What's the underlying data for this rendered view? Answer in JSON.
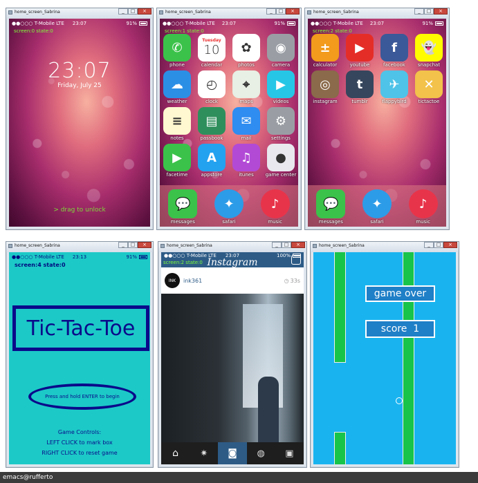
{
  "window_title": "home_screen_Sabrina",
  "titlebar_controls": [
    "_",
    "□",
    "×"
  ],
  "status": {
    "carrier": "●●○○○ T-Mobile   LTE",
    "battery": "91%"
  },
  "screen0": {
    "debug": "screen:0 state:0",
    "time_status": "23:07",
    "clock": "23:07",
    "date": "Friday, July 25",
    "unlock": "> drag to unlock"
  },
  "screen1": {
    "debug": "screen:1 state:0",
    "time_status": "23:07",
    "apps": [
      {
        "label": "phone",
        "color": "#3bc24a",
        "glyph": "✆"
      },
      {
        "label": "calendar",
        "color": "#ffffff",
        "glyph": "10",
        "sub": "Tuesday"
      },
      {
        "label": "photos",
        "color": "#ffffff",
        "glyph": "✿"
      },
      {
        "label": "camera",
        "color": "#9a9ea4",
        "glyph": "◉"
      },
      {
        "label": "weather",
        "color": "#2c8fe6",
        "glyph": "☁"
      },
      {
        "label": "clock",
        "color": "#ffffff",
        "glyph": "◴"
      },
      {
        "label": "maps",
        "color": "#e8efe4",
        "glyph": "⌖"
      },
      {
        "label": "videos",
        "color": "#26c7e6",
        "glyph": "▶"
      },
      {
        "label": "notes",
        "color": "#fff8d0",
        "glyph": "≡"
      },
      {
        "label": "passbook",
        "color": "#2f8f5c",
        "glyph": "▤"
      },
      {
        "label": "mail",
        "color": "#2f8cf0",
        "glyph": "✉"
      },
      {
        "label": "settings",
        "color": "#9a9ea4",
        "glyph": "⚙"
      },
      {
        "label": "facetime",
        "color": "#3bc24a",
        "glyph": "▶"
      },
      {
        "label": "appstore",
        "color": "#23a2f0",
        "glyph": "A"
      },
      {
        "label": "itunes",
        "color": "#b24ad6",
        "glyph": "♫"
      },
      {
        "label": "game center",
        "color": "#e8e8ee",
        "glyph": "●"
      }
    ],
    "dock": [
      {
        "label": "messages",
        "color": "#3bc24a",
        "glyph": "💬"
      },
      {
        "label": "safari",
        "color": "#2c9ce8",
        "glyph": "✦"
      },
      {
        "label": "music",
        "color": "#e8344a",
        "glyph": "♪"
      }
    ]
  },
  "screen2": {
    "debug": "screen:2 state:0",
    "time_status": "23:07",
    "apps": [
      {
        "label": "calculator",
        "color": "#f29b1c",
        "glyph": "±"
      },
      {
        "label": "youtube",
        "color": "#e52d27",
        "glyph": "▶"
      },
      {
        "label": "facebook",
        "color": "#3b5998",
        "glyph": "f"
      },
      {
        "label": "snapchat",
        "color": "#fffc00",
        "glyph": "👻"
      },
      {
        "label": "instagram",
        "color": "#8a6a4a",
        "glyph": "◎"
      },
      {
        "label": "tumblr",
        "color": "#36465d",
        "glyph": "t"
      },
      {
        "label": "flappybird",
        "color": "#4fc3e8",
        "glyph": "✈"
      },
      {
        "label": "tictactoe",
        "color": "#f2c24a",
        "glyph": "✕"
      }
    ],
    "dock": [
      {
        "label": "messages",
        "color": "#3bc24a",
        "glyph": "💬"
      },
      {
        "label": "safari",
        "color": "#2c9ce8",
        "glyph": "✦"
      },
      {
        "label": "music",
        "color": "#e8344a",
        "glyph": "♪"
      }
    ]
  },
  "screen4": {
    "debug": "screen:4 state:0",
    "time_status": "23:13",
    "title": "Tic-Tac-Toe",
    "start": "Press and hold ENTER to begin",
    "controls_title": "Game Controls:",
    "controls": [
      "LEFT CLICK to mark box",
      "RIGHT CLICK to reset game"
    ]
  },
  "instagram": {
    "debug": "screen:2 state:0",
    "time_status": "23:07",
    "brand": "Instagram",
    "user": "ink361",
    "age": "33s",
    "tabs": [
      "home",
      "explore",
      "camera",
      "activity",
      "profile"
    ]
  },
  "flappy": {
    "game_over": "game over",
    "score": "score  1"
  },
  "terminal": {
    "text": "emacs@rufferto"
  }
}
